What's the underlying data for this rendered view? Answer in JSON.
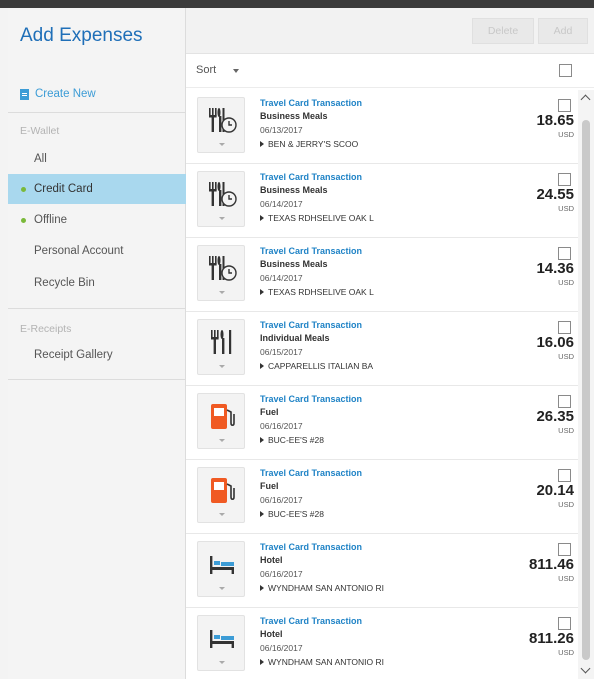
{
  "sidebar": {
    "title": "Add Expenses",
    "create_new": "Create New",
    "ewallet_header": "E-Wallet",
    "items": [
      {
        "label": "All",
        "dot": false,
        "active": false
      },
      {
        "label": "Credit Card",
        "dot": true,
        "active": true
      },
      {
        "label": "Offline",
        "dot": true,
        "active": false
      },
      {
        "label": "Personal Account",
        "dot": false,
        "active": false
      },
      {
        "label": "Recycle Bin",
        "dot": false,
        "active": false
      }
    ],
    "ereceipts_header": "E-Receipts",
    "receipt_gallery": "Receipt Gallery"
  },
  "toolbar": {
    "delete_label": "Delete",
    "add_label": "Add"
  },
  "list": {
    "sort_label": "Sort",
    "transactions": [
      {
        "type": "Travel Card Transaction",
        "category": "Business Meals",
        "date": "06/13/2017",
        "merchant": "BEN & JERRY'S SCOO",
        "amount": "18.65",
        "currency": "USD",
        "icon": "business-meals-icon"
      },
      {
        "type": "Travel Card Transaction",
        "category": "Business Meals",
        "date": "06/14/2017",
        "merchant": "TEXAS RDHSELIVE OAK L",
        "amount": "24.55",
        "currency": "USD",
        "icon": "business-meals-icon"
      },
      {
        "type": "Travel Card Transaction",
        "category": "Business Meals",
        "date": "06/14/2017",
        "merchant": "TEXAS RDHSELIVE OAK L",
        "amount": "14.36",
        "currency": "USD",
        "icon": "business-meals-icon"
      },
      {
        "type": "Travel Card Transaction",
        "category": "Individual Meals",
        "date": "06/15/2017",
        "merchant": "CAPPARELLIS ITALIAN BA",
        "amount": "16.06",
        "currency": "USD",
        "icon": "individual-meals-icon"
      },
      {
        "type": "Travel Card Transaction",
        "category": "Fuel",
        "date": "06/16/2017",
        "merchant": "BUC-EE'S #28",
        "amount": "26.35",
        "currency": "USD",
        "icon": "fuel-pump-icon"
      },
      {
        "type": "Travel Card Transaction",
        "category": "Fuel",
        "date": "06/16/2017",
        "merchant": "BUC-EE'S #28",
        "amount": "20.14",
        "currency": "USD",
        "icon": "fuel-pump-icon"
      },
      {
        "type": "Travel Card Transaction",
        "category": "Hotel",
        "date": "06/16/2017",
        "merchant": "WYNDHAM SAN ANTONIO RI",
        "amount": "811.46",
        "currency": "USD",
        "icon": "hotel-bed-icon"
      },
      {
        "type": "Travel Card Transaction",
        "category": "Hotel",
        "date": "06/16/2017",
        "merchant": "WYNDHAM SAN ANTONIO RI",
        "amount": "811.26",
        "currency": "USD",
        "icon": "hotel-bed-icon"
      }
    ]
  },
  "colors": {
    "accent_blue": "#1f83c6",
    "active_item": "#a9d8ee",
    "status_dot": "#7ab93a",
    "fuel_orange": "#f05a23"
  }
}
